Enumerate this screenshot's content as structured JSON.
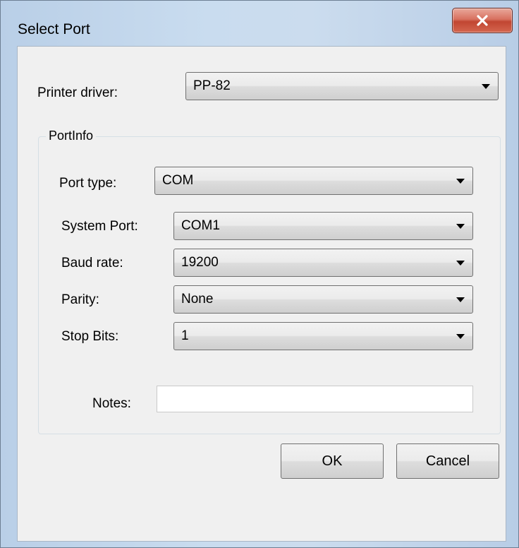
{
  "window": {
    "title": "Select Port",
    "close_glyph": "✕"
  },
  "printer_driver": {
    "label": "Printer driver:",
    "value": "PP-82"
  },
  "port_info": {
    "group_title": "PortInfo",
    "port_type": {
      "label": "Port type:",
      "value": "COM"
    },
    "system_port": {
      "label": "System Port:",
      "value": "COM1"
    },
    "baud_rate": {
      "label": "Baud rate:",
      "value": "19200"
    },
    "parity": {
      "label": "Parity:",
      "value": "None"
    },
    "stop_bits": {
      "label": "Stop Bits:",
      "value": "1"
    },
    "notes": {
      "label": "Notes:",
      "value": ""
    }
  },
  "buttons": {
    "ok": "OK",
    "cancel": "Cancel"
  },
  "colors": {
    "frame": "#c4d7ec",
    "close_button": "#c8503d",
    "client_bg": "#f0f0f0"
  },
  "icons": {
    "close": "close-icon",
    "dropdown": "chevron-down-icon"
  }
}
